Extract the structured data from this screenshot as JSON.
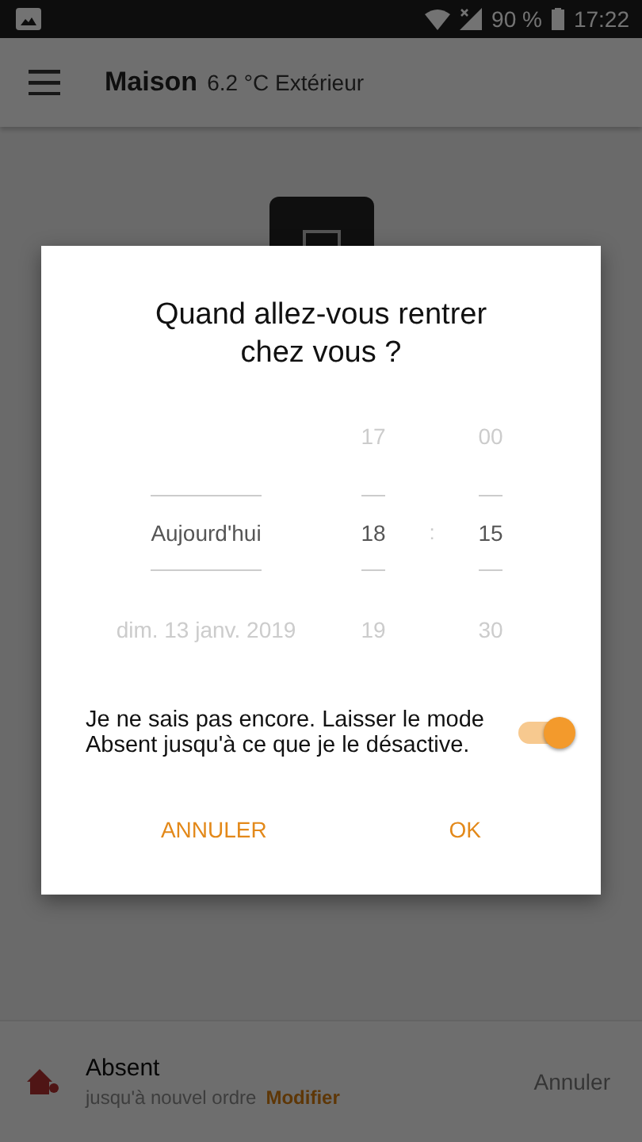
{
  "status_bar": {
    "battery": "90 %",
    "time": "17:22"
  },
  "app_bar": {
    "title": "Maison",
    "subtitle": "6.2 °C Extérieur"
  },
  "bottom_bar": {
    "mode": "Absent",
    "detail": "jusqu'à nouvel ordre",
    "link": "Modifier",
    "action": "Annuler"
  },
  "dialog": {
    "title": "Quand allez-vous rentrer chez vous ?",
    "picker": [
      {
        "kind": "date",
        "items": [
          {
            "label": "Aujourd'hui",
            "selected": true
          },
          {
            "label": "dim. 13 janv. 2019",
            "selected": false
          }
        ]
      },
      {
        "kind": "hour",
        "items": [
          {
            "label": "17",
            "selected": false
          },
          {
            "label": "18",
            "selected": true
          },
          {
            "label": "19",
            "selected": false
          }
        ]
      },
      {
        "kind": "minute",
        "items": [
          {
            "label": "00",
            "selected": false
          },
          {
            "label": "15",
            "selected": true
          },
          {
            "label": "30",
            "selected": false
          }
        ]
      }
    ],
    "separator": ":",
    "toggle": {
      "label": "Je ne sais pas encore. Laisser le mode Absent jusqu'à ce que je le désactive.",
      "on": true
    },
    "buttons": [
      "ANNULER",
      "OK"
    ]
  }
}
